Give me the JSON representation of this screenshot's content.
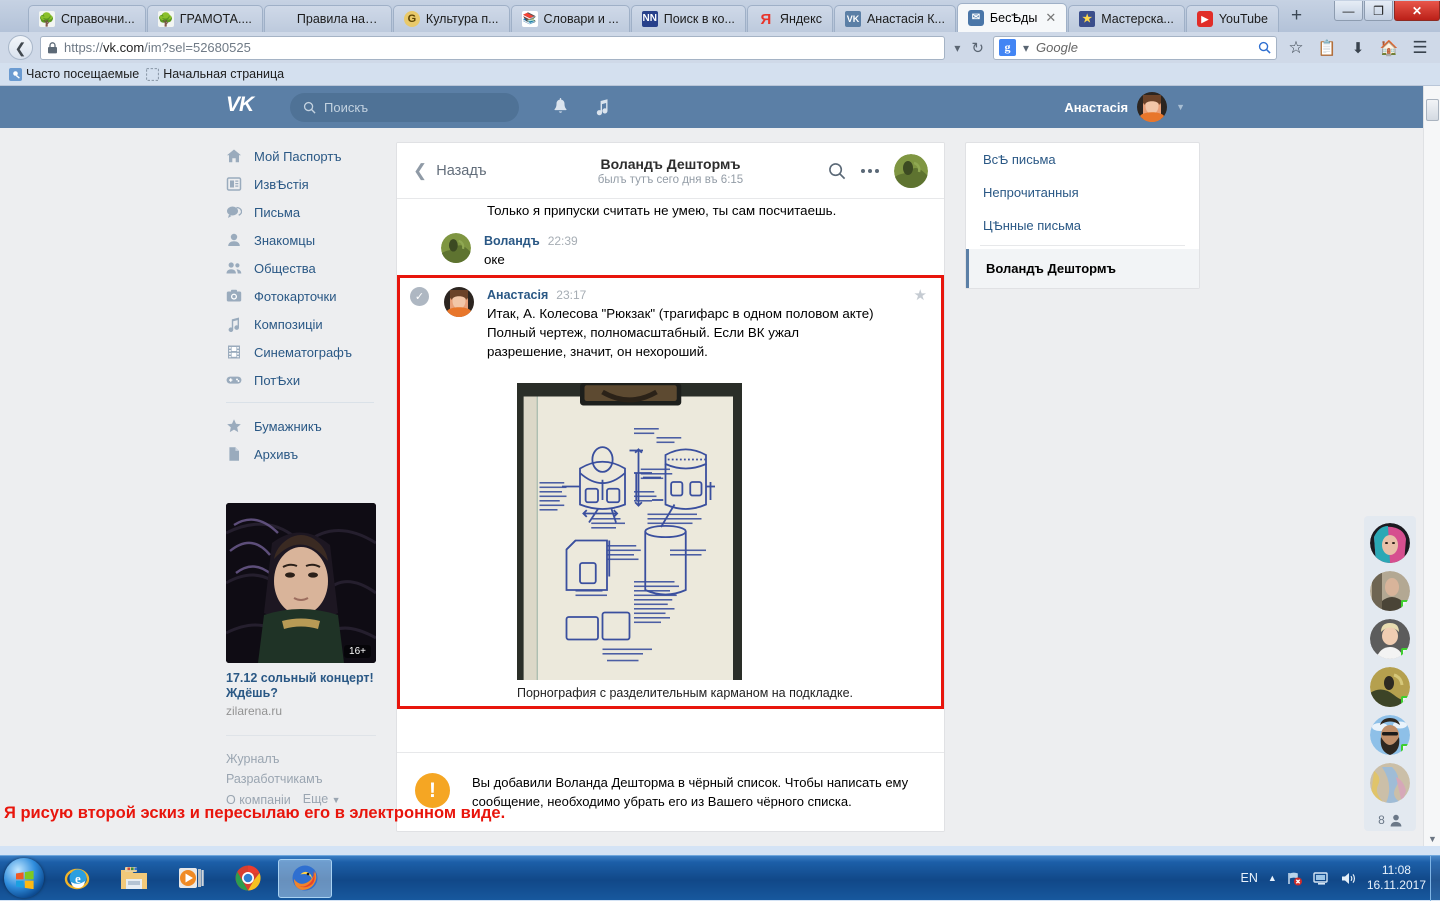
{
  "browser": {
    "tabs": [
      {
        "label": "Справочни...",
        "icon": "gramota-icon",
        "active": false
      },
      {
        "label": "ГРАМОТА....",
        "icon": "gramota-icon",
        "active": false
      },
      {
        "label": "Правила напис...",
        "icon": "page-icon",
        "active": false
      },
      {
        "label": "Культура п...",
        "icon": "kultura-icon",
        "active": false
      },
      {
        "label": "Словари и ...",
        "icon": "books-icon",
        "active": false
      },
      {
        "label": "Поиск в ко...",
        "icon": "search-corpus-icon",
        "active": false
      },
      {
        "label": "Яндекс",
        "icon": "yandex-icon",
        "active": false
      },
      {
        "label": "Анастасія К...",
        "icon": "vk-icon",
        "active": false
      },
      {
        "label": "БесѢды",
        "icon": "vk-messages-icon",
        "active": true
      },
      {
        "label": "Мастерска...",
        "icon": "masterskaya-icon",
        "active": false
      },
      {
        "label": "YouTube",
        "icon": "youtube-icon",
        "active": false
      }
    ],
    "new_tab_label": "+",
    "close_tab_label": "✕",
    "window_controls": {
      "minimize": "—",
      "maximize": "❐",
      "close": "✕"
    },
    "url_prefix": "https://",
    "url_host": "vk.com",
    "url_path": "/im?sel=52680525",
    "search_placeholder": "Google",
    "bookmarks": [
      {
        "label": "Часто посещаемые",
        "icon": "bookmark-folder-icon"
      },
      {
        "label": "Начальная страница",
        "icon": "blank-page-icon"
      }
    ]
  },
  "vk_header": {
    "logo": "VK",
    "search_placeholder": "Поискъ",
    "user_name": "Анастасія",
    "icons": [
      "bell-icon",
      "music-note-icon"
    ]
  },
  "sidebar": {
    "items": [
      {
        "label": "Мой Паспортъ",
        "icon": "home-icon"
      },
      {
        "label": "ИзвѢстія",
        "icon": "news-icon"
      },
      {
        "label": "Письма",
        "icon": "messages-icon"
      },
      {
        "label": "Знакомцы",
        "icon": "friends-icon"
      },
      {
        "label": "Общества",
        "icon": "groups-icon"
      },
      {
        "label": "Фотокарточки",
        "icon": "photos-icon"
      },
      {
        "label": "Композиціи",
        "icon": "music-icon"
      },
      {
        "label": "Синематографъ",
        "icon": "video-icon"
      },
      {
        "label": "ПотѢхи",
        "icon": "games-icon"
      }
    ],
    "items_secondary": [
      {
        "label": "Бумажникъ",
        "icon": "star-icon"
      },
      {
        "label": "Архивъ",
        "icon": "document-icon"
      }
    ]
  },
  "ad": {
    "badge": "16+",
    "title_line1": "17.12 сольный концерт!",
    "title_line2": "Ждёшь?",
    "url": "zilarena.ru"
  },
  "footer": {
    "links": [
      "Журналъ",
      "Разработчикамъ",
      "О компаніи"
    ],
    "more": "Еще"
  },
  "chat": {
    "back_label": "Назадъ",
    "title": "Воландъ Дештормъ",
    "subtitle": "былъ тутъ сего дня въ 6:15",
    "actions": [
      "search-icon",
      "more-options-icon",
      "chat-avatar"
    ],
    "messages": [
      {
        "name": "",
        "time": "",
        "text": "Только я припуски считать не умею, ты сам посчитаешь.",
        "partial": true
      },
      {
        "name": "Воландъ",
        "time": "22:39",
        "text": "оке",
        "partial": false
      },
      {
        "name": "Анастасія",
        "time": "23:17",
        "text_lines": [
          "Итак, А. Колесова \"Рюкзак\" (трагифарс в одном половом акте)",
          "Полный чертеж, полномасштабный. Если ВК ужал",
          "разрешение, значит, он нехороший."
        ],
        "highlighted": true,
        "attachment_caption": "Порнография с разделительным карманом на подкладке.",
        "check_icon": "check-icon",
        "star_icon": "star-icon"
      }
    ],
    "annotation": "Я рисую второй эскиз и пересылаю его в электронном виде.",
    "annotation_color": "#e8150c",
    "notice": {
      "icon": "warning-icon",
      "text": "Вы добавили Воланда Дешторма в чёрный список. Чтобы написать ему сообщение, необходимо убрать его из Вашего чёрного списка."
    }
  },
  "right_panel": {
    "filters": [
      "ВсѢ письма",
      "Непрочитанныя",
      "ЦѢнные письма"
    ],
    "active_dialog": "Воландъ Дештормъ"
  },
  "friends_strip": {
    "count": "8",
    "count_icon": "person-icon",
    "friends": [
      {
        "online": false
      },
      {
        "online": true
      },
      {
        "online": true
      },
      {
        "online": true
      },
      {
        "online": true
      },
      {
        "online": false
      }
    ]
  },
  "taskbar": {
    "start_label": "start-orb",
    "apps": [
      {
        "name": "internet-explorer-icon",
        "active": false
      },
      {
        "name": "file-explorer-icon",
        "active": false
      },
      {
        "name": "media-player-icon",
        "active": false
      },
      {
        "name": "google-chrome-icon",
        "active": false
      },
      {
        "name": "firefox-icon",
        "active": true
      }
    ],
    "language": "EN",
    "tray_icons": [
      "show-hidden-icon",
      "network-error-icon",
      "monitor-icon",
      "volume-icon"
    ],
    "time": "11:08",
    "date": "16.11.2017"
  }
}
